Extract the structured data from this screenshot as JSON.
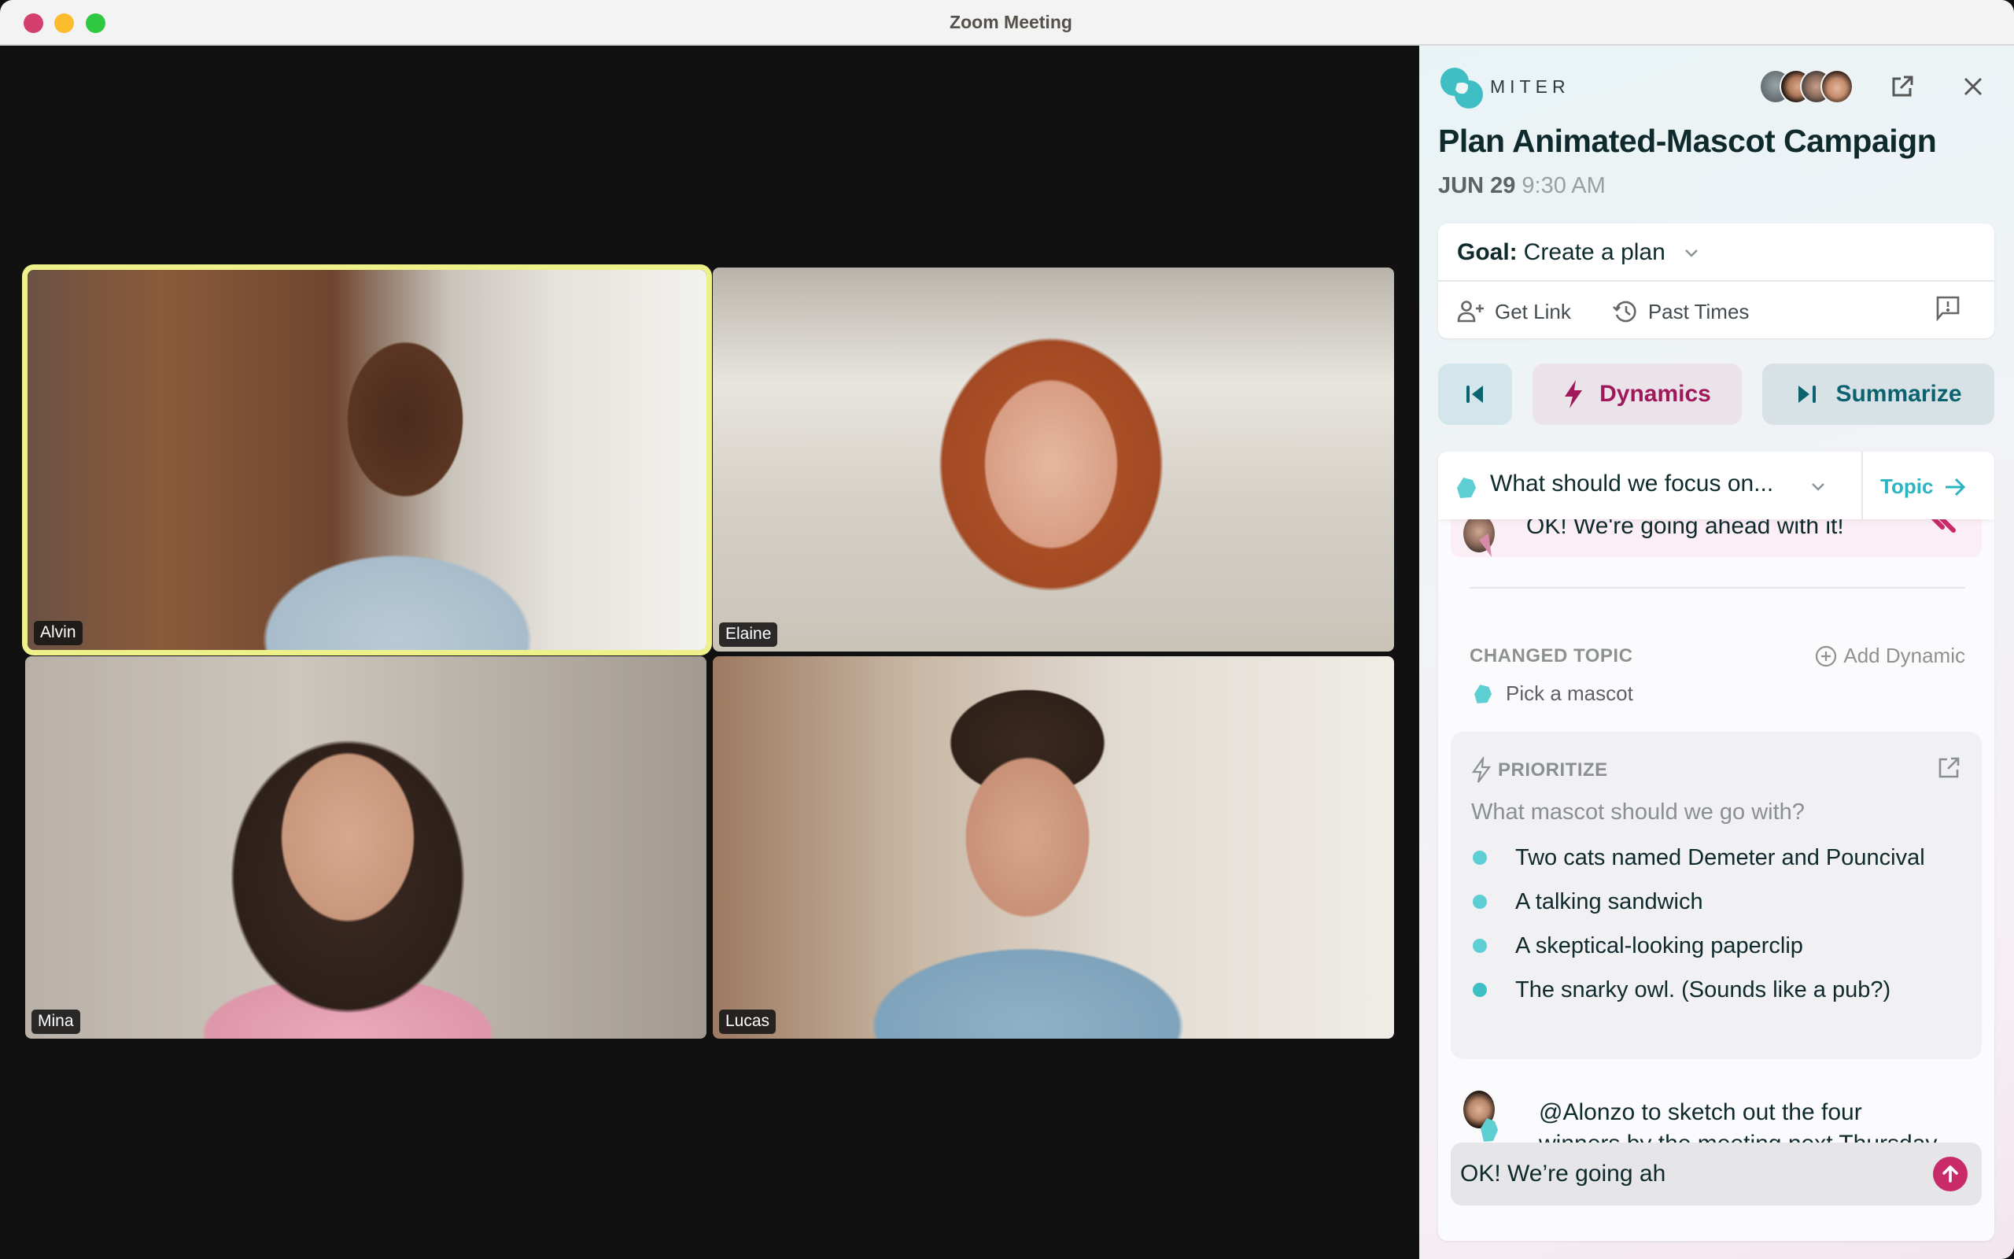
{
  "window": {
    "title": "Zoom Meeting"
  },
  "participants": [
    {
      "name": "Alvin",
      "active_speaker": true
    },
    {
      "name": "Elaine",
      "active_speaker": false
    },
    {
      "name": "Mina",
      "active_speaker": false
    },
    {
      "name": "Lucas",
      "active_speaker": false
    }
  ],
  "panel": {
    "brand": "MITER",
    "header_avatar_count": 4,
    "icons": {
      "popout": "external-link-icon",
      "close": "close-icon"
    },
    "meeting_title": "Plan Animated-Mascot Campaign",
    "date": "JUN 29",
    "time": "9:30 AM",
    "goal": {
      "label": "Goal:",
      "value": "Create a plan"
    },
    "actions": {
      "get_link": "Get Link",
      "past_times": "Past Times"
    },
    "buttons": {
      "dynamics": "Dynamics",
      "summarize": "Summarize"
    },
    "topic": {
      "current": "What should we focus on...",
      "next_label": "Topic"
    },
    "previous_message": "OK! We're going ahead with it!",
    "changed_topic": {
      "label": "CHANGED TOPIC",
      "add_dynamic": "Add Dynamic",
      "topic": "Pick a mascot"
    },
    "dynamic": {
      "type": "PRIORITIZE",
      "question": "What mascot should we go with?",
      "options": [
        "Two cats named Demeter and Pouncival",
        "A talking sandwich",
        "A skeptical-looking paperclip",
        "The snarky owl. (Sounds like a pub?)"
      ]
    },
    "note": "@Alonzo to sketch out the four winners by the meeting next Thursday and then we’ll decide",
    "composer": {
      "value": "OK! We’re going ah"
    }
  },
  "colors": {
    "brand_teal": "#2bb5c0",
    "accent_magenta": "#c82b67",
    "active_speaker_border": "#eef08a"
  }
}
